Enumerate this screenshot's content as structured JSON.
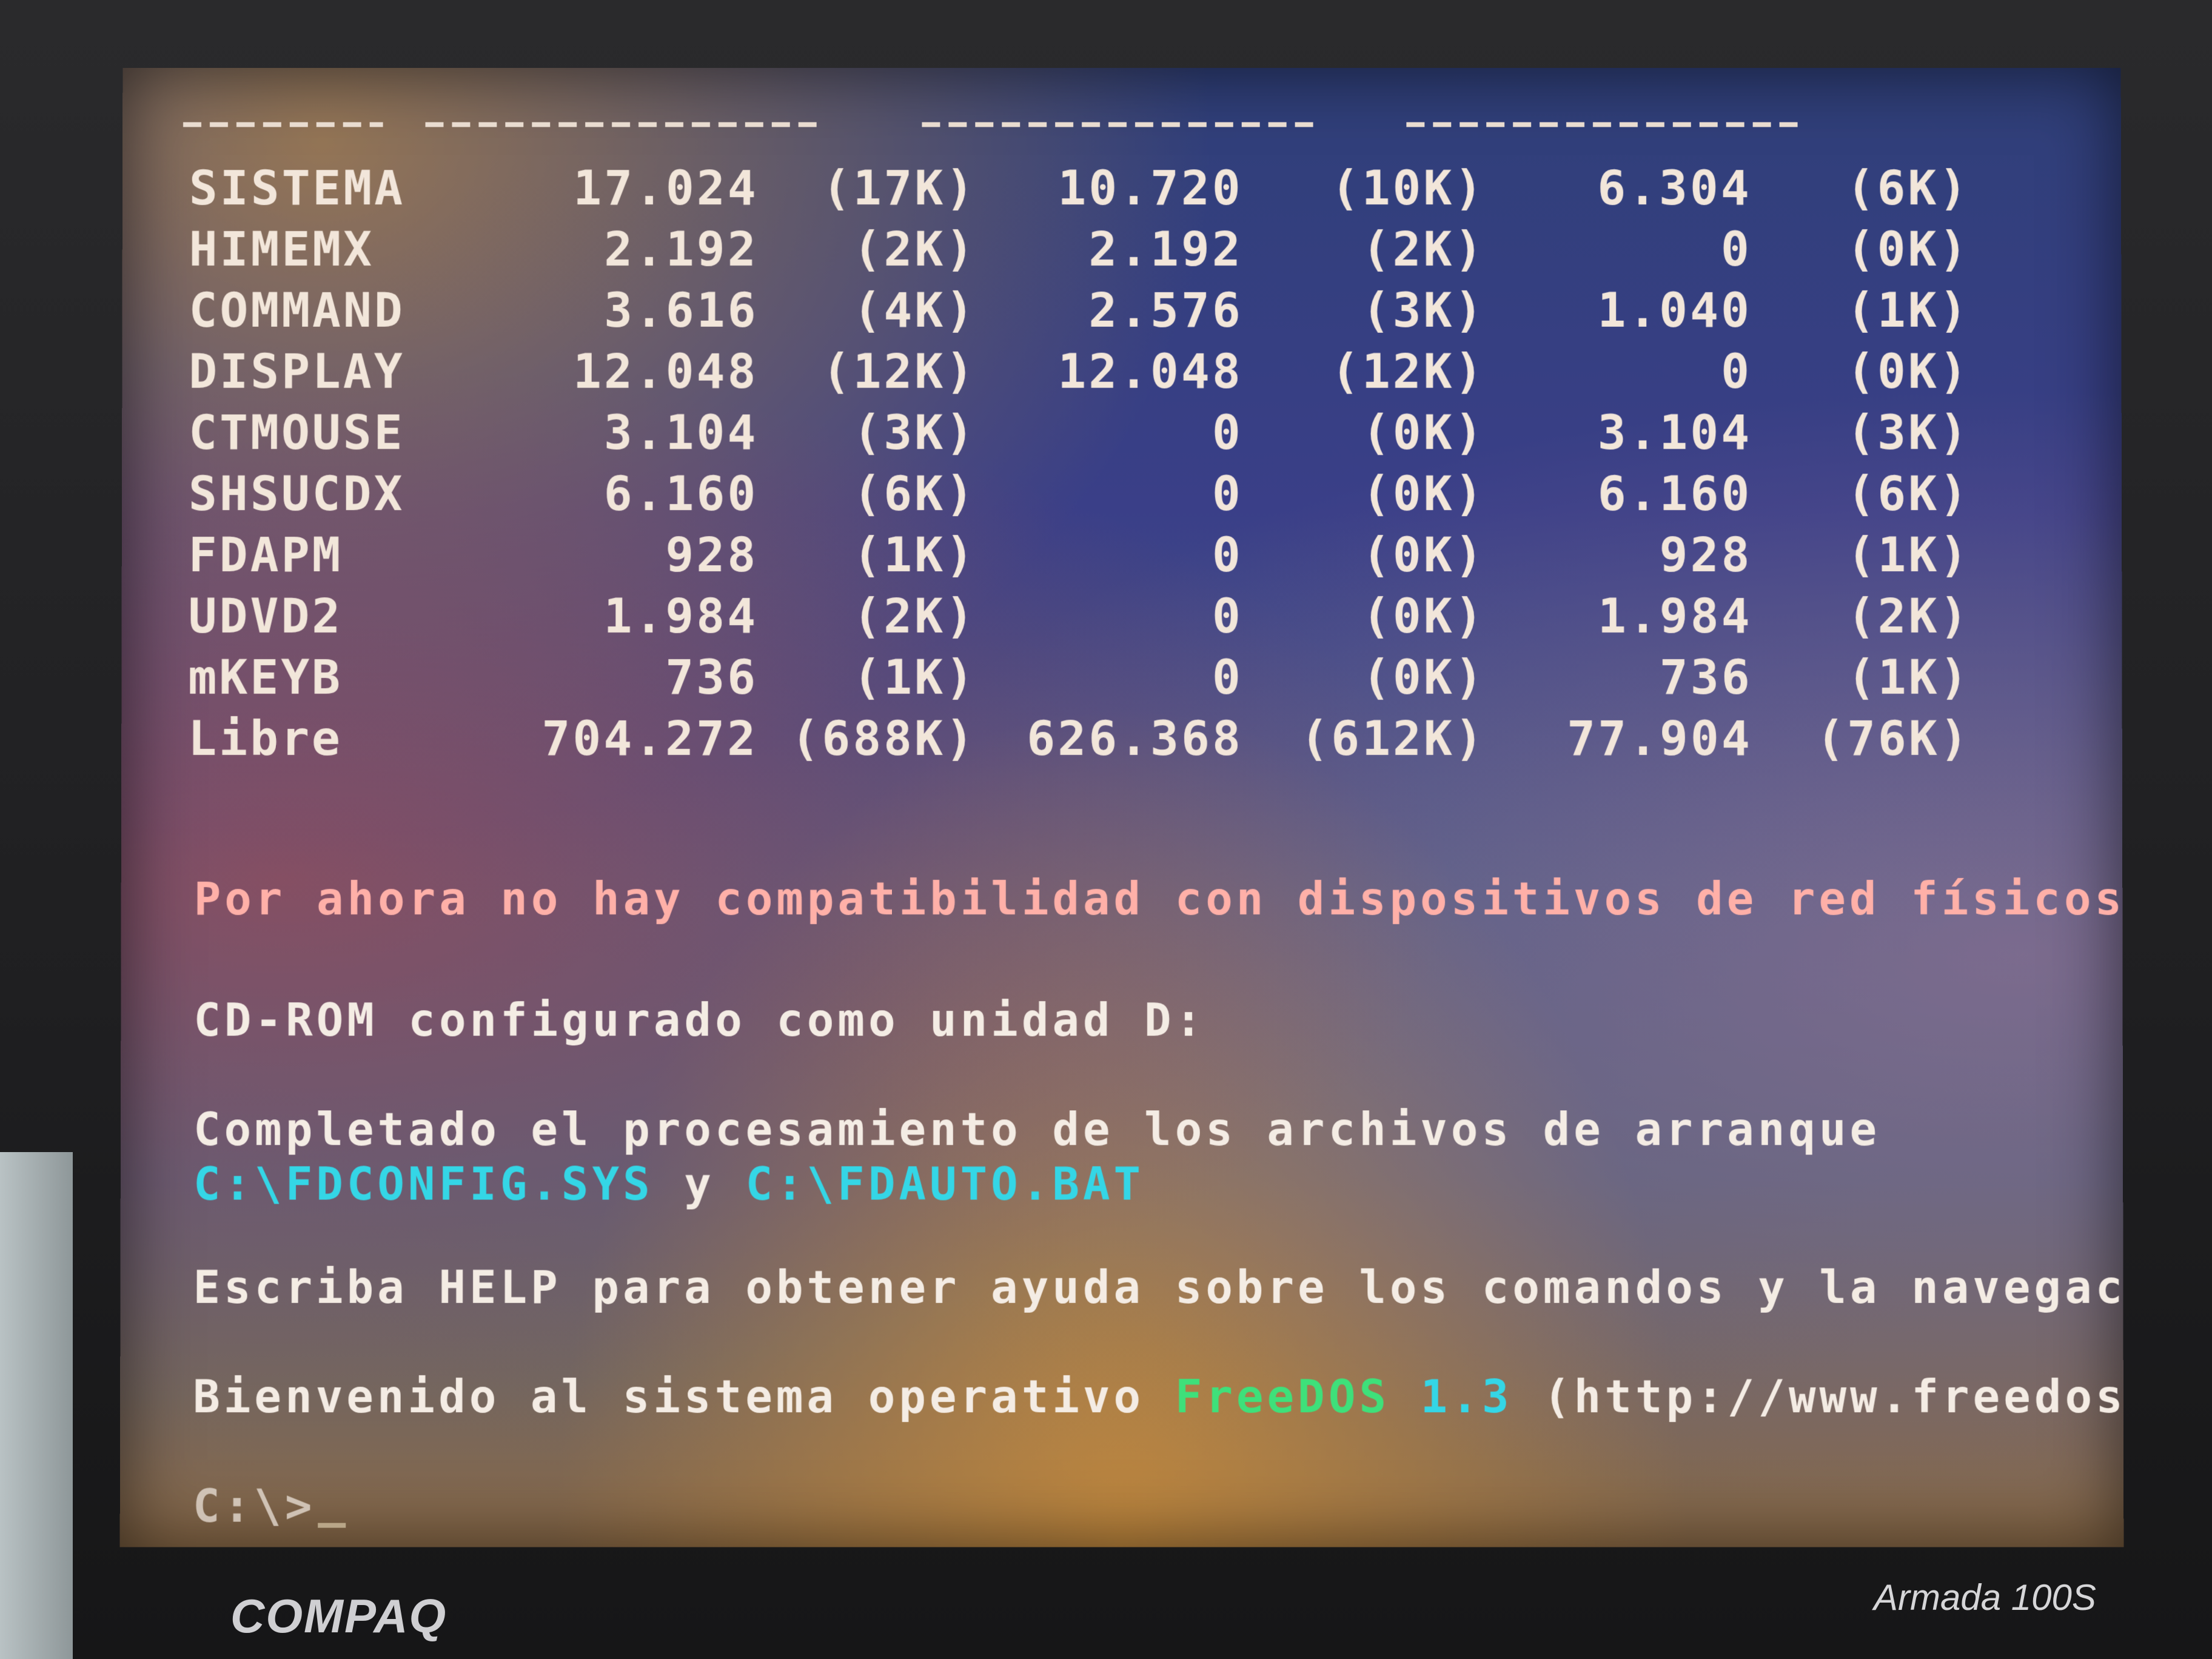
{
  "memory_table": {
    "rows": [
      {
        "name": "SISTEMA",
        "total": "17.024",
        "total_k": "(17K)",
        "conv": "10.720",
        "conv_k": "(10K)",
        "upper": "6.304",
        "upper_k": "(6K)"
      },
      {
        "name": "HIMEMX",
        "total": "2.192",
        "total_k": "(2K)",
        "conv": "2.192",
        "conv_k": "(2K)",
        "upper": "0",
        "upper_k": "(0K)"
      },
      {
        "name": "COMMAND",
        "total": "3.616",
        "total_k": "(4K)",
        "conv": "2.576",
        "conv_k": "(3K)",
        "upper": "1.040",
        "upper_k": "(1K)"
      },
      {
        "name": "DISPLAY",
        "total": "12.048",
        "total_k": "(12K)",
        "conv": "12.048",
        "conv_k": "(12K)",
        "upper": "0",
        "upper_k": "(0K)"
      },
      {
        "name": "CTMOUSE",
        "total": "3.104",
        "total_k": "(3K)",
        "conv": "0",
        "conv_k": "(0K)",
        "upper": "3.104",
        "upper_k": "(3K)"
      },
      {
        "name": "SHSUCDX",
        "total": "6.160",
        "total_k": "(6K)",
        "conv": "0",
        "conv_k": "(0K)",
        "upper": "6.160",
        "upper_k": "(6K)"
      },
      {
        "name": "FDAPM",
        "total": "928",
        "total_k": "(1K)",
        "conv": "0",
        "conv_k": "(0K)",
        "upper": "928",
        "upper_k": "(1K)"
      },
      {
        "name": "UDVD2",
        "total": "1.984",
        "total_k": "(2K)",
        "conv": "0",
        "conv_k": "(0K)",
        "upper": "1.984",
        "upper_k": "(2K)"
      },
      {
        "name": "mKEYB",
        "total": "736",
        "total_k": "(1K)",
        "conv": "0",
        "conv_k": "(0K)",
        "upper": "736",
        "upper_k": "(1K)"
      },
      {
        "name": "Libre",
        "total": "704.272",
        "total_k": "(688K)",
        "conv": "626.368",
        "conv_k": "(612K)",
        "upper": "77.904",
        "upper_k": "(76K)"
      }
    ]
  },
  "messages": {
    "network": "Por ahora no hay compatibilidad con dispositivos de red físicos.",
    "cdrom": "CD-ROM configurado como unidad D:",
    "boot_done": "Completado el procesamiento de los archivos de arranque",
    "config_file": "C:\\FDCONFIG.SYS",
    "and": " y ",
    "auto_file": "C:\\FDAUTO.BAT",
    "help": "Escriba HELP para obtener ayuda sobre los comandos y la navegación.",
    "welcome_prefix": "Bienvenido al sistema operativo ",
    "welcome_os": "FreeDOS",
    "welcome_version": " 1.3",
    "welcome_url": " (http://www.freedos.org)",
    "prompt": "C:\\>"
  },
  "device": {
    "brand": "COMPAQ",
    "model": "Armada 100S"
  },
  "colors": {
    "text": "#f2e6da",
    "pink_text": "#ffb0a8",
    "path_cyan": "#34d6e6",
    "freedos_green": "#3ee07a"
  }
}
